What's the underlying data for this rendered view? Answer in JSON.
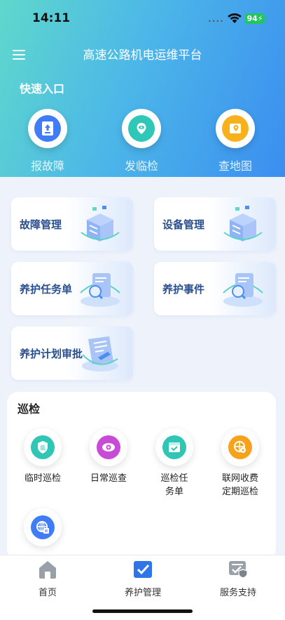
{
  "status": {
    "time": "14:11",
    "battery": "94"
  },
  "header": {
    "title": "高速公路机电运维平台",
    "quick_label": "快速入口"
  },
  "quick": [
    {
      "label": "报故障",
      "color": "#3f7cf6",
      "icon": "report-fault-icon"
    },
    {
      "label": "发临检",
      "color": "#2ec7b8",
      "icon": "temp-inspection-icon"
    },
    {
      "label": "查地图",
      "color": "#f7b21b",
      "icon": "map-icon"
    }
  ],
  "modules": [
    {
      "label": "故障管理"
    },
    {
      "label": "设备管理"
    },
    {
      "label": "养护任务单"
    },
    {
      "label": "养护事件"
    },
    {
      "label": "养护计划审批"
    }
  ],
  "patrol": {
    "title": "巡检",
    "items": [
      {
        "label": "临时巡检",
        "color": "#2fc6b6",
        "icon": "temp-patrol-icon",
        "glyph": "临"
      },
      {
        "label": "日常巡查",
        "color": "#c74bd6",
        "icon": "eye-icon",
        "glyph": ""
      },
      {
        "label": "巡检任务单",
        "color": "#2fc6b6",
        "icon": "task-list-icon",
        "glyph": ""
      },
      {
        "label": "联网收费定期巡检",
        "color": "#f7a21b",
        "icon": "toll-inspection-icon",
        "glyph": ""
      },
      {
        "label": "",
        "color": "#3f7cf6",
        "icon": "globe-grid-icon",
        "glyph": ""
      }
    ]
  },
  "tabs": [
    {
      "label": "首页"
    },
    {
      "label": "养护管理"
    },
    {
      "label": "服务支持"
    }
  ]
}
